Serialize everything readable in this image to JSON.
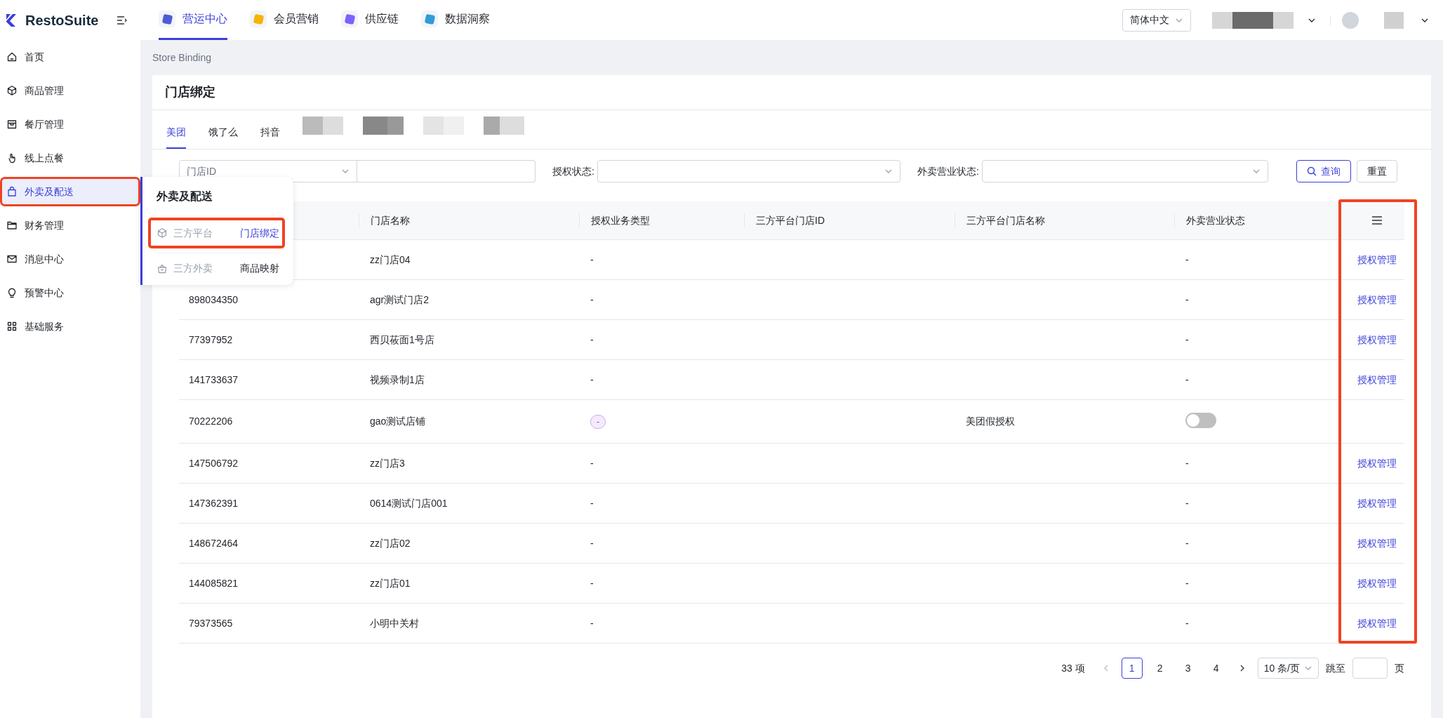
{
  "logo": {
    "text": "RestoSuite"
  },
  "top_nav": [
    {
      "label": "营运中心",
      "selected": true,
      "color": "#4f5bd5"
    },
    {
      "label": "会员营销",
      "selected": false,
      "color": "#f5b400"
    },
    {
      "label": "供应链",
      "selected": false,
      "color": "#7b61ff"
    },
    {
      "label": "数据洞察",
      "selected": false,
      "color": "#2f9bd9"
    }
  ],
  "language_select": {
    "value": "简体中文"
  },
  "sidebar": {
    "items": [
      {
        "label": "首页",
        "selected": false,
        "kind": "home"
      },
      {
        "label": "商品管理",
        "selected": false,
        "kind": "cube"
      },
      {
        "label": "餐厅管理",
        "selected": false,
        "kind": "store"
      },
      {
        "label": "线上点餐",
        "selected": false,
        "kind": "hand"
      },
      {
        "label": "外卖及配送",
        "selected": true,
        "kind": "bag"
      },
      {
        "label": "财务管理",
        "selected": false,
        "kind": "folder"
      },
      {
        "label": "消息中心",
        "selected": false,
        "kind": "mail"
      },
      {
        "label": "预警中心",
        "selected": false,
        "kind": "bulb"
      },
      {
        "label": "基础服务",
        "selected": false,
        "kind": "grid"
      }
    ]
  },
  "flyout": {
    "title": "外卖及配送",
    "groups": [
      {
        "label": "三方平台",
        "kind": "cube",
        "item": "门店绑定",
        "selected": true
      },
      {
        "label": "三方外卖",
        "kind": "basket",
        "item": "商品映射",
        "selected": false
      }
    ]
  },
  "breadcrumb": "Store Binding",
  "page_title": "门店绑定",
  "platform_tabs": [
    {
      "label": "美团",
      "selected": true
    },
    {
      "label": "饿了么",
      "selected": false
    },
    {
      "label": "抖音",
      "selected": false
    }
  ],
  "filters": {
    "id_select": "门店ID",
    "auth_status_label": "授权状态:",
    "business_status_label": "外卖营业状态:",
    "search_button": "查询",
    "reset_button": "重置"
  },
  "table": {
    "columns": [
      "门店名称",
      "授权业务类型",
      "三方平台门店ID",
      "三方平台门店名称",
      "外卖营业状态"
    ],
    "rows": [
      {
        "name": "zz门店04",
        "auth_type": {
          "kind": "text",
          "text": "-"
        },
        "business_status": {
          "kind": "text",
          "text": "-"
        },
        "action": "授权管理"
      },
      {
        "id": "898034350",
        "name": "agr测试门店2",
        "auth_type": {
          "kind": "text",
          "text": "-"
        },
        "business_status": {
          "kind": "text",
          "text": "-"
        },
        "action": "授权管理"
      },
      {
        "id": "77397952",
        "name": "西贝莜面1号店",
        "auth_type": {
          "kind": "text",
          "text": "-"
        },
        "business_status": {
          "kind": "text",
          "text": "-"
        },
        "action": "授权管理"
      },
      {
        "id": "141733637",
        "name": "视频录制1店",
        "auth_type": {
          "kind": "text",
          "text": "-"
        },
        "business_status": {
          "kind": "text",
          "text": "-"
        },
        "action": "授权管理"
      },
      {
        "id": "70222206",
        "name": "gao测试店铺",
        "auth_type": {
          "kind": "tag",
          "text": "-"
        },
        "platform_store_name": "美团假授权",
        "business_status": {
          "kind": "switch",
          "on": false
        }
      },
      {
        "id": "147506792",
        "name": "zz门店3",
        "auth_type": {
          "kind": "text",
          "text": "-"
        },
        "business_status": {
          "kind": "text",
          "text": "-"
        },
        "action": "授权管理"
      },
      {
        "id": "147362391",
        "name": "0614测试门店001",
        "auth_type": {
          "kind": "text",
          "text": "-"
        },
        "business_status": {
          "kind": "text",
          "text": "-"
        },
        "action": "授权管理"
      },
      {
        "id": "148672464",
        "name": "zz门店02",
        "auth_type": {
          "kind": "text",
          "text": "-"
        },
        "business_status": {
          "kind": "text",
          "text": "-"
        },
        "action": "授权管理"
      },
      {
        "id": "144085821",
        "name": "zz门店01",
        "auth_type": {
          "kind": "text",
          "text": "-"
        },
        "business_status": {
          "kind": "text",
          "text": "-"
        },
        "action": "授权管理"
      },
      {
        "id": "79373565",
        "name": "小明中关村",
        "auth_type": {
          "kind": "text",
          "text": "-"
        },
        "business_status": {
          "kind": "text",
          "text": "-"
        },
        "action": "授权管理"
      }
    ]
  },
  "pagination": {
    "total": "33 项",
    "pages": [
      {
        "label": "1",
        "selected": true
      },
      {
        "label": "2",
        "selected": false
      },
      {
        "label": "3",
        "selected": false
      },
      {
        "label": "4",
        "selected": false
      }
    ],
    "page_size": "10 条/页",
    "jump_label": "跳至",
    "page_unit": "页"
  }
}
